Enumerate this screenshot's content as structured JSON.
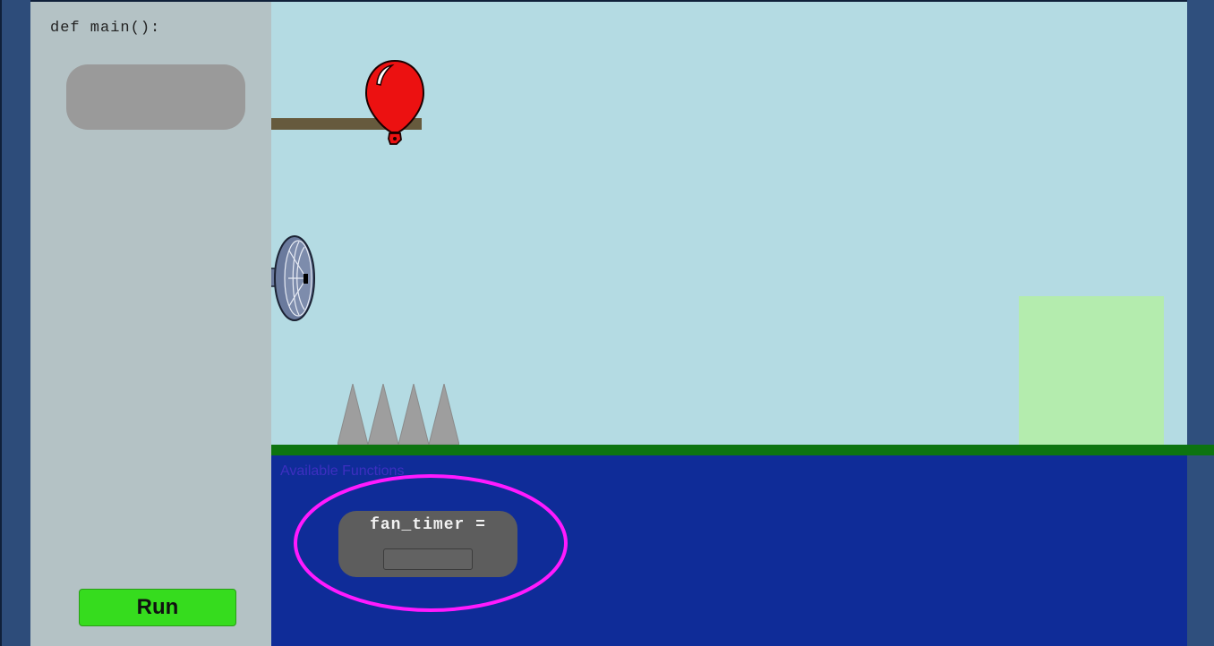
{
  "code_panel": {
    "header": "def main():",
    "run_label": "Run"
  },
  "game": {
    "sprites": {
      "balloon": "red-balloon-icon",
      "fan": "fan-icon",
      "spikes": "spikes-icon"
    }
  },
  "available": {
    "label": "Available Functions",
    "block": {
      "label": "fan_timer =",
      "value": "",
      "placeholder": ""
    }
  },
  "colors": {
    "run_button": "#36dc1e",
    "highlight": "#ff1aff",
    "sky": "#b4dbe3",
    "goal": "#b4ecae",
    "ground": "#0d7410",
    "panel": "#0f2c98"
  }
}
